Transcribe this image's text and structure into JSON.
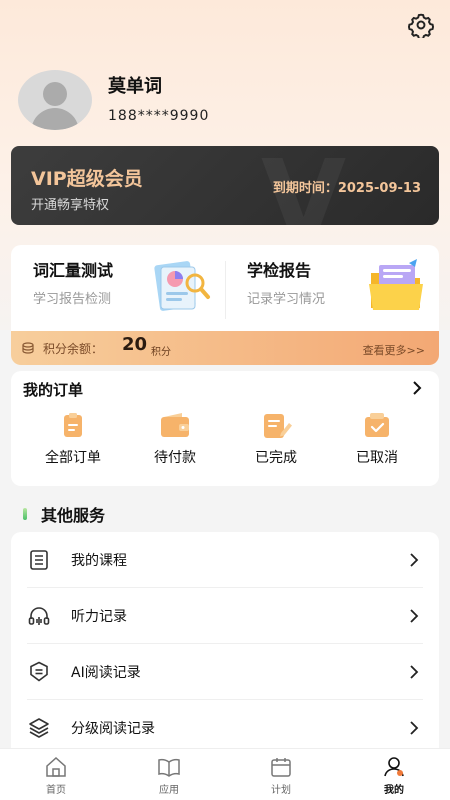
{
  "profile": {
    "name": "莫单词",
    "phone": "188****9990"
  },
  "vip": {
    "title": "VIP超级会员",
    "subtitle": "开通畅享特权",
    "expire_label": "到期时间：",
    "expire_date": "2025-09-13",
    "bg_letter": "V"
  },
  "cards": [
    {
      "title": "词汇量测试",
      "subtitle": "学习报告检测"
    },
    {
      "title": "学检报告",
      "subtitle": "记录学习情况"
    }
  ],
  "points": {
    "label": "积分余额：",
    "value": "20",
    "unit": "积分",
    "more": "查看更多>>"
  },
  "orders": {
    "title": "我的订单",
    "items": [
      {
        "label": "全部订单"
      },
      {
        "label": "待付款"
      },
      {
        "label": "已完成"
      },
      {
        "label": "已取消"
      }
    ]
  },
  "services": {
    "title": "其他服务",
    "items": [
      {
        "label": "我的课程",
        "icon": "course-icon"
      },
      {
        "label": "听力记录",
        "icon": "headphones-icon"
      },
      {
        "label": "AI阅读记录",
        "icon": "ai-reading-icon"
      },
      {
        "label": "分级阅读记录",
        "icon": "layers-icon"
      }
    ]
  },
  "tabbar": {
    "items": [
      {
        "label": "首页",
        "icon": "home-icon",
        "active": false
      },
      {
        "label": "应用",
        "icon": "book-icon",
        "active": false
      },
      {
        "label": "计划",
        "icon": "calendar-icon",
        "active": false
      },
      {
        "label": "我的",
        "icon": "profile-icon",
        "active": true
      }
    ]
  },
  "colors": {
    "accent_orange": "#f3a874",
    "vip_gold": "#f3c59a",
    "icon_orange": "#f6b36a"
  }
}
